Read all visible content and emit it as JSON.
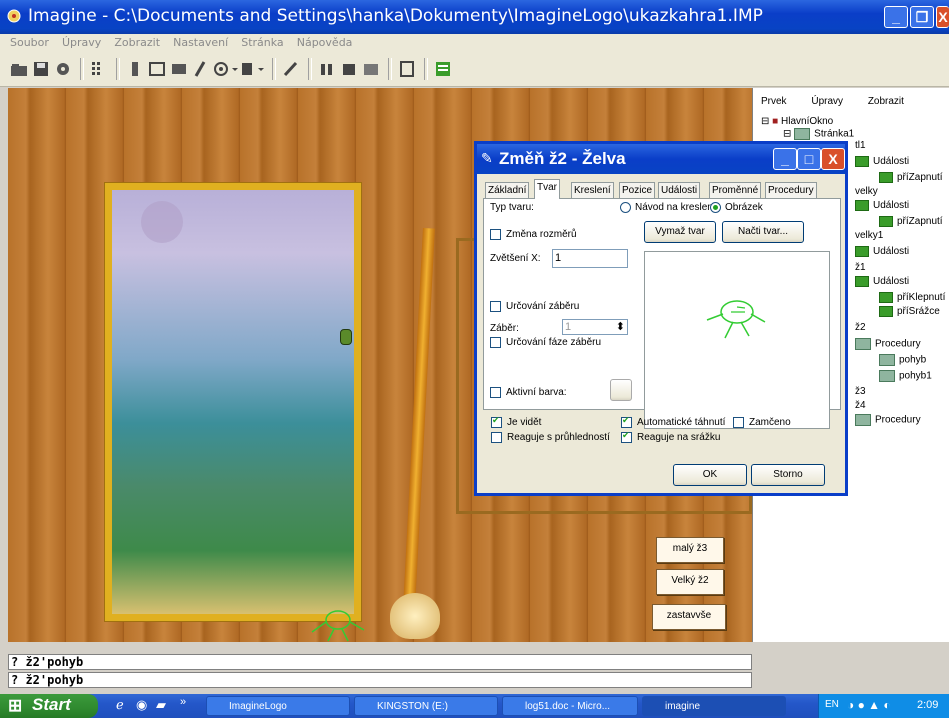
{
  "window": {
    "title": "Imagine - C:\\Documents and Settings\\hanka\\Dokumenty\\ImagineLogo\\ukazkahra1.IMP"
  },
  "menu": [
    "Soubor",
    "Úpravy",
    "Zobrazit",
    "Nastavení",
    "Stránka",
    "Nápověda"
  ],
  "right_panel": {
    "menu": [
      "Prvek",
      "Úpravy",
      "Zobrazit"
    ],
    "tree": [
      {
        "label": "HlavníOkno",
        "icon": "window-icon"
      },
      {
        "label": "Stránka1",
        "icon": "page-icon"
      },
      {
        "label": "tl1",
        "icon": ""
      },
      {
        "label": "Události",
        "icon": "folder-icon"
      },
      {
        "label": "příZapnutí",
        "icon": "folder-icon"
      },
      {
        "label": "velky",
        "icon": ""
      },
      {
        "label": "Události",
        "icon": "folder-icon"
      },
      {
        "label": "příZapnutí",
        "icon": "folder-icon"
      },
      {
        "label": "velky1",
        "icon": ""
      },
      {
        "label": "Události",
        "icon": "folder-icon"
      },
      {
        "label": "ž1",
        "icon": ""
      },
      {
        "label": "Události",
        "icon": "folder-icon"
      },
      {
        "label": "příKlepnutí",
        "icon": "folder-icon"
      },
      {
        "label": "příSrážce",
        "icon": "folder-icon"
      },
      {
        "label": "ž2",
        "icon": ""
      },
      {
        "label": "Procedury",
        "icon": "proc-icon"
      },
      {
        "label": "pohyb",
        "icon": "proc-icon"
      },
      {
        "label": "pohyb1",
        "icon": "proc-icon"
      },
      {
        "label": "ž3",
        "icon": ""
      },
      {
        "label": "ž4",
        "icon": ""
      },
      {
        "label": "Procedury",
        "icon": "proc-icon"
      }
    ]
  },
  "dialog": {
    "title": "Změň ž2  - Želva",
    "tabs": [
      "Základní",
      "Tvar",
      "Kreslení",
      "Pozice",
      "Události",
      "Proměnné",
      "Procedury"
    ],
    "typ_tvaru": "Typ tvaru:",
    "radio1": "Návod na kreslení",
    "radio2": "Obrázek",
    "zmena": "Změna rozměrů",
    "vymaz": "Vymaž tvar",
    "nacti": "Načti tvar...",
    "zvetseni_label": "Zvětšení X:",
    "zvetseni_value": "1",
    "urcovani_zaberu": "Určování záběru",
    "zaber_label": "Záběr:",
    "zaber_value": "1",
    "urcovani_faze": "Určování fáze záběru",
    "aktivni_barva": "Aktivní barva:",
    "je_videt": "Je vidět",
    "automaticke": "Automatické táhnutí",
    "zamceno": "Zamčeno",
    "reaguje_pruhl": "Reaguje s průhledností",
    "reaguje_srazku": "Reaguje na srážku",
    "ok": "OK",
    "storno": "Storno"
  },
  "stage_buttons": [
    "malý ž3",
    "Velký ž2",
    "zastavvše"
  ],
  "command_lines": [
    "? ž2'pohyb",
    "? ž2'pohyb"
  ],
  "taskbar": {
    "start": "Start",
    "tasks": [
      "ImagineLogo",
      "KINGSTON (E:)",
      "log51.doc - Micro...",
      "imagine"
    ],
    "lang": "EN",
    "time": "2:09"
  }
}
